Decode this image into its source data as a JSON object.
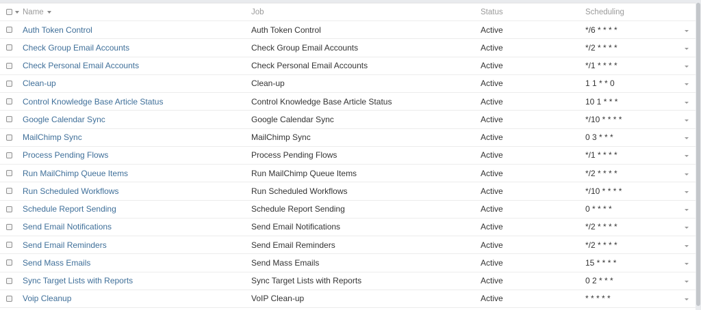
{
  "header": {
    "name": "Name",
    "job": "Job",
    "status": "Status",
    "scheduling": "Scheduling"
  },
  "rows": [
    {
      "name": "Auth Token Control",
      "job": "Auth Token Control",
      "status": "Active",
      "scheduling": "*/6 * * * *"
    },
    {
      "name": "Check Group Email Accounts",
      "job": "Check Group Email Accounts",
      "status": "Active",
      "scheduling": "*/2 * * * *"
    },
    {
      "name": "Check Personal Email Accounts",
      "job": "Check Personal Email Accounts",
      "status": "Active",
      "scheduling": "*/1 * * * *"
    },
    {
      "name": "Clean-up",
      "job": "Clean-up",
      "status": "Active",
      "scheduling": "1 1 * * 0"
    },
    {
      "name": "Control Knowledge Base Article Status",
      "job": "Control Knowledge Base Article Status",
      "status": "Active",
      "scheduling": "10 1 * * *"
    },
    {
      "name": "Google Calendar Sync",
      "job": "Google Calendar Sync",
      "status": "Active",
      "scheduling": "*/10 * * * *"
    },
    {
      "name": "MailChimp Sync",
      "job": "MailChimp Sync",
      "status": "Active",
      "scheduling": "0 3 * * *"
    },
    {
      "name": "Process Pending Flows",
      "job": "Process Pending Flows",
      "status": "Active",
      "scheduling": "*/1 * * * *"
    },
    {
      "name": "Run MailChimp Queue Items",
      "job": "Run MailChimp Queue Items",
      "status": "Active",
      "scheduling": "*/2 * * * *"
    },
    {
      "name": "Run Scheduled Workflows",
      "job": "Run Scheduled Workflows",
      "status": "Active",
      "scheduling": "*/10 * * * *"
    },
    {
      "name": "Schedule Report Sending",
      "job": "Schedule Report Sending",
      "status": "Active",
      "scheduling": "0 * * * *"
    },
    {
      "name": "Send Email Notifications",
      "job": "Send Email Notifications",
      "status": "Active",
      "scheduling": "*/2 * * * *"
    },
    {
      "name": "Send Email Reminders",
      "job": "Send Email Reminders",
      "status": "Active",
      "scheduling": "*/2 * * * *"
    },
    {
      "name": "Send Mass Emails",
      "job": "Send Mass Emails",
      "status": "Active",
      "scheduling": "15 * * * *"
    },
    {
      "name": "Sync Target Lists with Reports",
      "job": "Sync Target Lists with Reports",
      "status": "Active",
      "scheduling": "0 2 * * *"
    },
    {
      "name": "Voip Cleanup",
      "job": "VoIP Clean-up",
      "status": "Active",
      "scheduling": "* * * * *"
    }
  ],
  "colors": {
    "link": "#3f6f99",
    "header_text": "#9a9a9a",
    "row_border": "#ececec"
  },
  "icons": {
    "checkbox": "checkbox-icon",
    "caret": "caret-down-icon"
  }
}
